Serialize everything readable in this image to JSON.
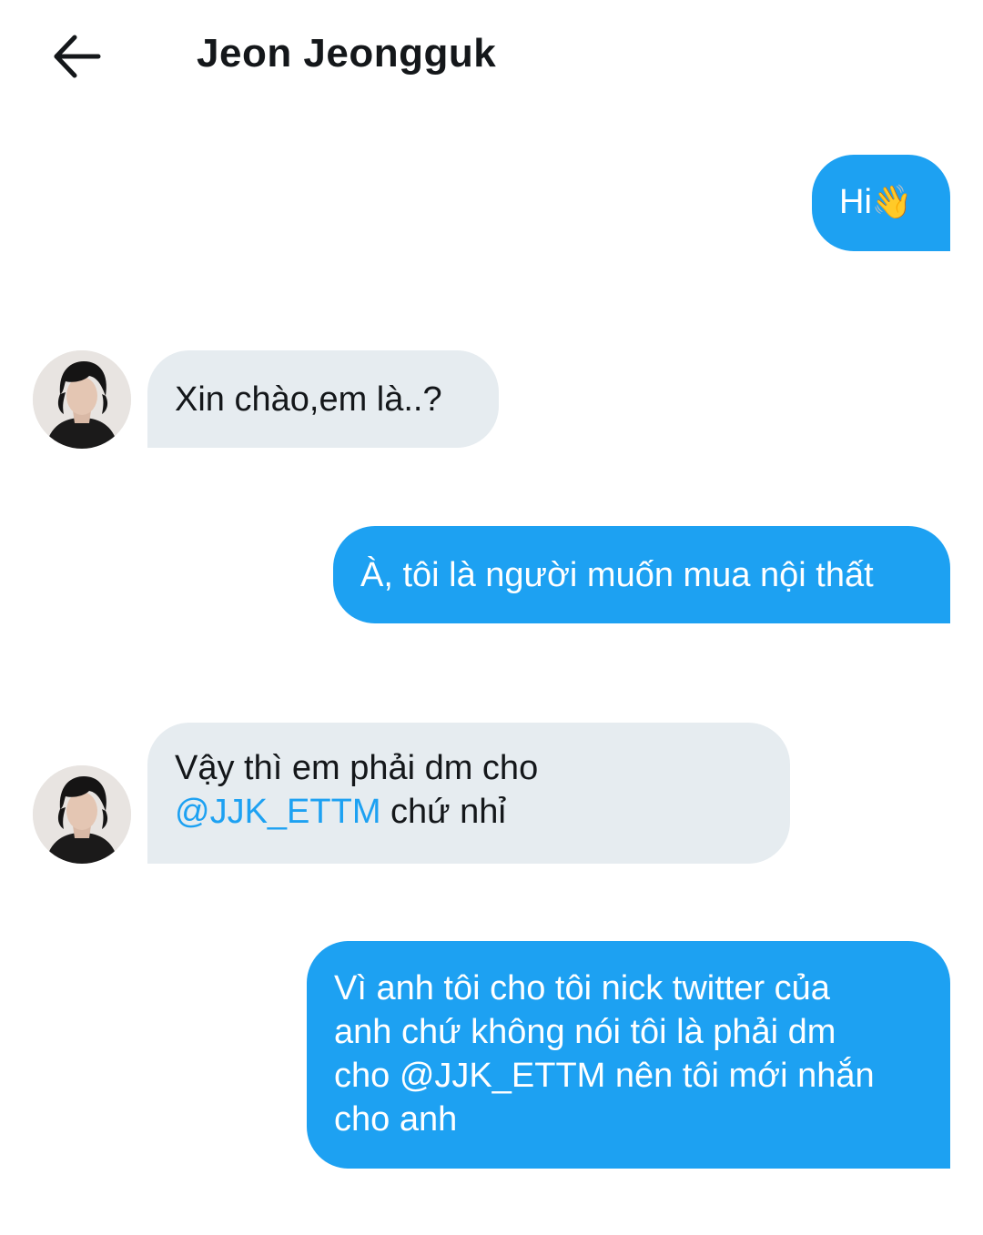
{
  "header": {
    "back_label": "back-arrow-icon",
    "title": "Jeon Jeongguk"
  },
  "messages": [
    {
      "from": "me",
      "text": "Hi",
      "emoji": "👋"
    },
    {
      "from": "them",
      "text": "Xin chào,em là..?"
    },
    {
      "from": "me",
      "text": "À, tôi là người muốn mua nội thất"
    },
    {
      "from": "them",
      "line1": "Vậy thì em phải dm cho",
      "mention": "@JJK_ETTM",
      "line2_rest": " chứ nhỉ"
    },
    {
      "from": "me",
      "lines": [
        "Vì anh tôi cho tôi nick twitter của",
        "anh chứ không nói tôi là phải dm",
        "cho @JJK_ETTM nên tôi mới nhắn",
        "cho anh"
      ]
    }
  ],
  "colors": {
    "sent_bubble": "#1da1f2",
    "received_bubble": "#e6ecf0",
    "mention": "#1da1f2",
    "text": "#14171a"
  }
}
